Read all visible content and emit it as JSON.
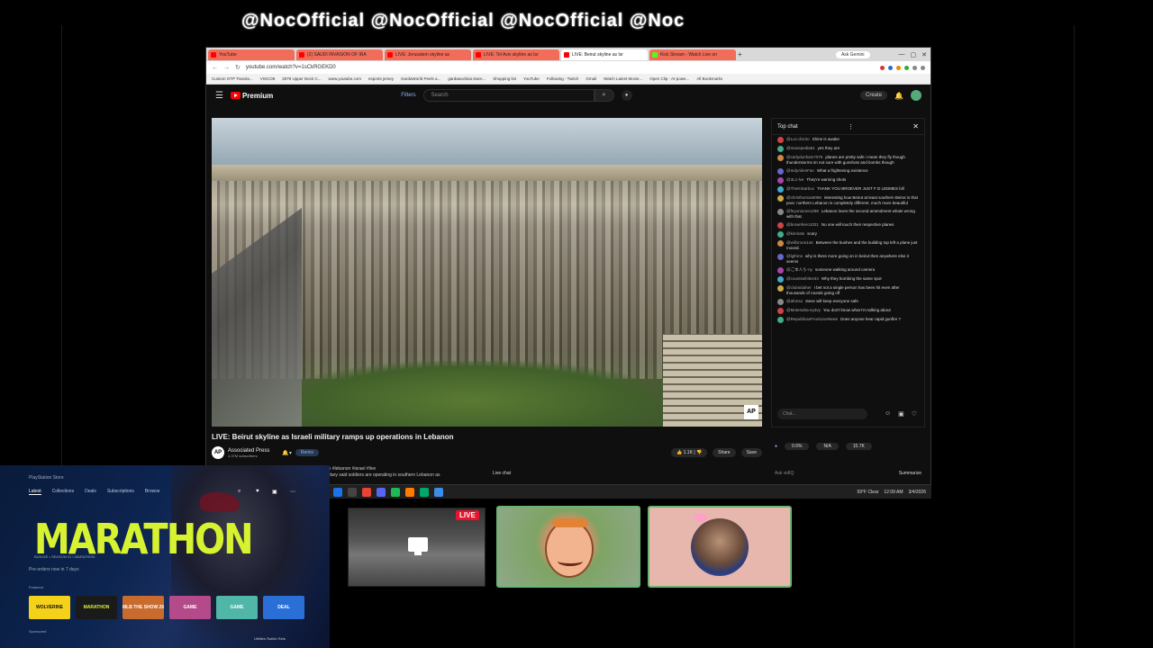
{
  "banner": {
    "text": "@NocOfficial @NocOfficial @NocOfficial @Noc"
  },
  "browser": {
    "tabs": [
      {
        "label": "YouTube"
      },
      {
        "label": "(2) SAUDI INVASION OF IRA"
      },
      {
        "label": "LIVE: Jerusalem skyline as"
      },
      {
        "label": "LIVE: Tel Aviv skyline as Isr"
      },
      {
        "label": "LIVE: Beirut skyline as Isr"
      },
      {
        "label": "Kick Stream - Watch Live on"
      }
    ],
    "ask_gemini": "Ask Gemini",
    "url": "youtube.com/watch?v=1sCkRGEKD0",
    "bookmarks": [
      "Custom GTP Transla...",
      "VISCO8",
      "2079 Upper Deck C...",
      "www.youtube.com",
      "esports jersey",
      "GardaWorld Peels a...",
      "gardaworldus.learn...",
      "Shopping list",
      "YouTube",
      "Following - Twitch",
      "Gmail",
      "Watch Latest Movie...",
      "Open Clip - AI-powe...",
      "All Bookmarks"
    ]
  },
  "youtube": {
    "logo_text": "Premium",
    "filters_label": "Filters",
    "search_placeholder": "Search",
    "create_label": "Create",
    "video": {
      "title": "LIVE: Beirut skyline as Israeli military ramps up operations in Lebanon",
      "channel": "Associated Press",
      "subscribers": "4.37M subscribers",
      "ap_badge": "AP",
      "remix_label": "Remix",
      "likes": "1.1K",
      "share_label": "Share",
      "save_label": "Save",
      "description_tags": "ago  #lebanon #israel #live",
      "description_text": "military said soldiers are operating in southern Lebanon as"
    },
    "chat": {
      "header": "Top chat",
      "messages": [
        {
          "user": "@Luc-d1z3o",
          "text": "Shine is awake"
        },
        {
          "user": "@mazepedia81",
          "text": "yes they are"
        },
        {
          "user": "@carlydunham7075",
          "text": "planes are pretty safe i mean they fly though thunderstorms im not sure with gunshots and bombs though"
        },
        {
          "user": "@IndyAlienFan",
          "text": "What a frightening existence"
        },
        {
          "user": "@3L1-lve",
          "text": "They're warning shots"
        },
        {
          "user": "@TheKStarbox",
          "text": "THANK YOU BROEVER JUST F D LEDMES bill"
        },
        {
          "user": "@christhomas6096",
          "text": "interesting how Beirut at least southern Beirut is that poor. northern Lebanon is completely different. much more beautiful"
        },
        {
          "user": "@feyonmore1298",
          "text": "Lebanon loves the second amendment whats wrong with that"
        },
        {
          "user": "@brownhero1021",
          "text": "No one will touch their respective planes"
        },
        {
          "user": "@kimirats",
          "text": "scary"
        },
        {
          "user": "@will1rons144",
          "text": "Between the bushes and the building top left a plane just moved."
        },
        {
          "user": "@lgthms",
          "text": "why is there more going on in beirut then anywhere else it seems"
        },
        {
          "user": "@ご本人ち-ny",
          "text": "someone walking around camera"
        },
        {
          "user": "@countswhite244",
          "text": "Why they bombing the same spot"
        },
        {
          "user": "@clubsidaher",
          "text": "I bet not a single person has been hit even after thousands of rounds going off"
        },
        {
          "user": "@afonso",
          "text": "steve will keep everyone safe"
        },
        {
          "user": "@Motenaha-ey3vy",
          "text": "You don't know what I'm talking about"
        },
        {
          "user": "@RepublicanFrontLiveNews",
          "text": "Does anyone hear rapid gunfire ?"
        }
      ],
      "input_placeholder": "Chat...",
      "live_chat_label": "Live chat",
      "stats": [
        "0.6%",
        "N/A",
        "15.7K"
      ],
      "ask_label": "Ask vidIQ",
      "summarize_label": "Summarize"
    }
  },
  "taskbar": {
    "weather": "59°F Clear",
    "time": "12:09 AM",
    "date": "3/4/2026"
  },
  "playstation": {
    "top_label": "PlayStation Store",
    "nav": [
      "Latest",
      "Collections",
      "Deals",
      "Subscriptions",
      "Browse"
    ],
    "game_title": "MARATHON",
    "game_sub": "BUNGIE • SEASON 01 • MARATHON",
    "playtime": "Pre-orders now in 7 days",
    "section_label": "Featured",
    "tiles": [
      "WOLVERINE",
      "MARATHON",
      "MLB THE SHOW 26",
      "GAME",
      "GAME",
      "DEAL"
    ],
    "footer": "Sponsored",
    "bottom": "Utilities   Switch Sets"
  },
  "stream": {
    "live_badge": "LIVE"
  },
  "colors": {
    "cam_border": "#6bb36e",
    "accent": "#d7f230",
    "live": "#e5152d"
  }
}
